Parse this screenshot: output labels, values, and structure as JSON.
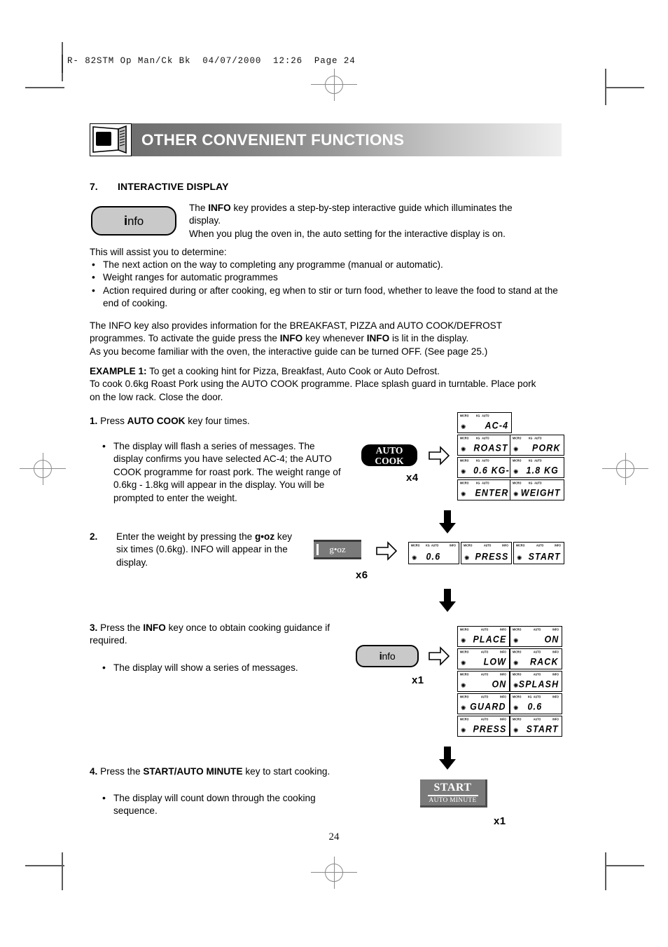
{
  "page": {
    "running_head": "R- 82STM Op Man/Ck Bk  04/07/2000  12:26  Page 24",
    "number": "24"
  },
  "banner": {
    "title": "OTHER CONVENIENT FUNCTIONS",
    "icon": "microwave-oven-icon",
    "gradient_from": "#6e6e6e",
    "gradient_to": "#efefef"
  },
  "section": {
    "number": "7.",
    "title": "INTERACTIVE DISPLAY",
    "info_key": {
      "bold": "i",
      "rest": "nfo"
    },
    "intro": {
      "line1_a": "The ",
      "line1_b": "INFO",
      "line1_c": " key provides a step-by-step interactive guide which illuminates the",
      "line2": "display.",
      "line3": "When you plug the oven in, the auto setting for the interactive display is on."
    },
    "assist_lead": "This will assist you to determine:",
    "assist_items": [
      "The next action on the way to completing any programme (manual or automatic).",
      "Weight ranges for automatic programmes",
      "Action required during or after cooking, eg when to stir or turn food, whether to leave the food to stand at the end of cooking."
    ],
    "para2": {
      "line1": "The INFO key also provides information for the BREAKFAST, PIZZA and AUTO COOK/DEFROST",
      "line2_a": "programmes. To activate the guide press the ",
      "line2_b": "INFO",
      "line2_c": " key whenever ",
      "line2_d": "INFO",
      "line2_e": " is lit in the display.",
      "line3": "As you become familiar with the oven, the interactive guide can be turned OFF. (See page 25.)"
    },
    "example": {
      "label": "EXAMPLE 1:",
      "line1_rest": " To get a cooking hint for Pizza, Breakfast, Auto Cook or Auto Defrost.",
      "line2": "To cook 0.6kg Roast Pork using the AUTO COOK programme. Place splash guard in turntable.  Place pork",
      "line3": "on the low rack. Close the door."
    }
  },
  "steps": [
    {
      "num": "1.",
      "lead_a": " Press ",
      "lead_b": "AUTO COOK",
      "lead_c": " key four times.",
      "bullets": [
        "The display will flash a series of messages. The display confirms you have selected AC-4; the AUTO COOK programme for roast pork. The weight range of 0.6kg - 1.8kg will appear in the display. You will be prompted to enter the weight."
      ],
      "key_label_line1": "AUTO",
      "key_label_line2": "COOK",
      "key_name": "auto-cook-key",
      "press_count": "x4",
      "displays": [
        {
          "tags": [
            "MICRO",
            "KG",
            "AUTO"
          ],
          "value": "AC-4",
          "align": "right"
        },
        {
          "tags": [
            "MICRO",
            "KG",
            "AUTO"
          ],
          "value": "ROAST",
          "align": "right"
        },
        {
          "tags": [
            "MICRO",
            "KG",
            "AUTO"
          ],
          "value": "PORK",
          "align": "right"
        },
        {
          "tags": [
            "MICRO",
            "KG",
            "AUTO"
          ],
          "value": "0.6 KG-",
          "align": "right"
        },
        {
          "tags": [
            "MICRO",
            "KG",
            "AUTO"
          ],
          "value": "1.8 KG",
          "align": "right"
        },
        {
          "tags": [
            "MICRO",
            "KG",
            "AUTO"
          ],
          "value": "ENTER",
          "align": "right"
        },
        {
          "tags": [
            "MICRO",
            "KG",
            "AUTO"
          ],
          "value": "WEIGHT",
          "align": "right"
        }
      ]
    },
    {
      "num": "2.",
      "lead_a": " Enter the weight by pressing the ",
      "lead_b": "g•oz",
      "lead_c": " key six times (0.6kg). INFO will appear in the display.",
      "key_label": "g•oz",
      "key_name": "g-oz-key",
      "press_count": "x6",
      "displays": [
        {
          "tags": [
            "MICRO",
            "KG",
            "AUTO",
            "INFO"
          ],
          "value": "0.6",
          "align": "left"
        },
        {
          "tags": [
            "MICRO",
            "AUTO",
            "INFO"
          ],
          "value": "PRESS",
          "align": "right"
        },
        {
          "tags": [
            "MICRO",
            "AUTO",
            "INFO"
          ],
          "value": "START",
          "align": "right"
        }
      ]
    },
    {
      "num": "3.",
      "lead_a": " Press the ",
      "lead_b": "INFO",
      "lead_c": " key once to obtain cooking guidance if required.",
      "bullets": [
        "The display will show a series of messages."
      ],
      "key_name": "info-key",
      "press_count": "x1",
      "displays": [
        {
          "tags": [
            "MICRO",
            "AUTO",
            "INFO"
          ],
          "value": "PLACE",
          "align": "right"
        },
        {
          "tags": [
            "MICRO",
            "AUTO",
            "INFO"
          ],
          "value": "ON",
          "align": "right"
        },
        {
          "tags": [
            "MICRO",
            "AUTO",
            "INFO"
          ],
          "value": "LOW",
          "align": "right"
        },
        {
          "tags": [
            "MICRO",
            "AUTO",
            "INFO"
          ],
          "value": "RACK",
          "align": "right"
        },
        {
          "tags": [
            "MICRO",
            "AUTO",
            "INFO"
          ],
          "value": "ON",
          "align": "right"
        },
        {
          "tags": [
            "MICRO",
            "AUTO",
            "INFO"
          ],
          "value": "SPLASH",
          "align": "right"
        },
        {
          "tags": [
            "MICRO",
            "AUTO",
            "INFO"
          ],
          "value": "GUARD",
          "align": "right"
        },
        {
          "tags": [
            "MICRO",
            "KG",
            "AUTO",
            "INFO"
          ],
          "value": "0.6",
          "align": "left"
        },
        {
          "tags": [
            "MICRO",
            "AUTO",
            "INFO"
          ],
          "value": "PRESS",
          "align": "right"
        },
        {
          "tags": [
            "MICRO",
            "AUTO",
            "INFO"
          ],
          "value": "START",
          "align": "right"
        }
      ]
    },
    {
      "num": "4.",
      "lead_a": " Press the ",
      "lead_b": "START/AUTO MINUTE",
      "lead_c": " key to start cooking.",
      "bullets": [
        "The display will count down through the cooking sequence."
      ],
      "key_label_line1": "START",
      "key_label_line2": "AUTO MINUTE",
      "key_name": "start-auto-minute-key",
      "press_count": "x1"
    }
  ]
}
